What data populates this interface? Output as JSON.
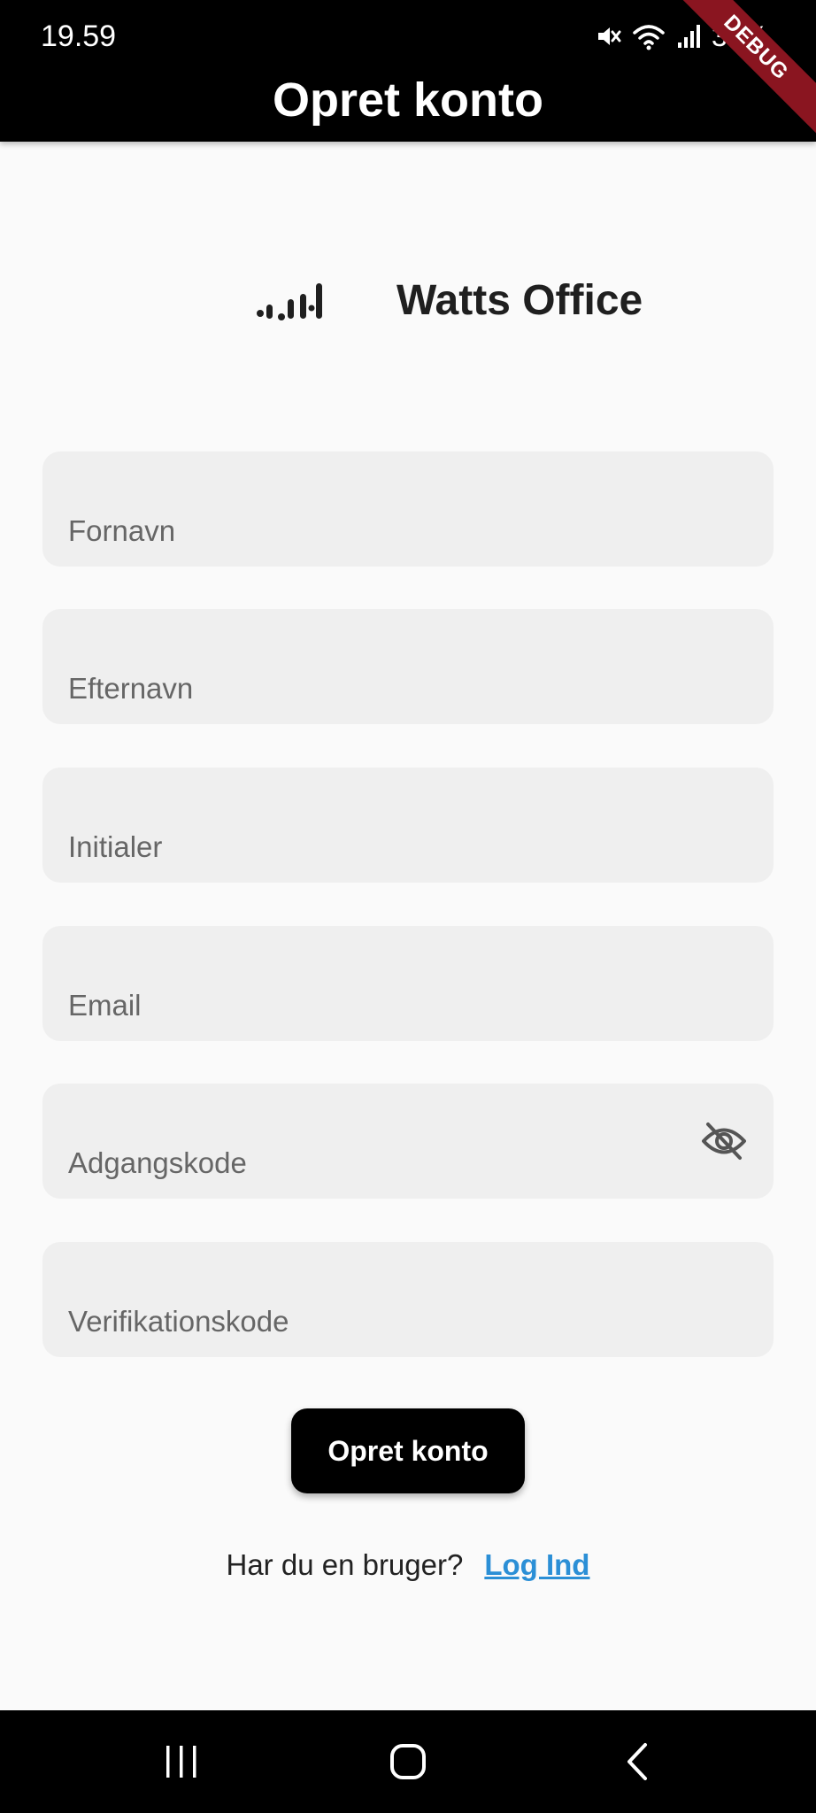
{
  "status_bar": {
    "time": "19.59",
    "battery": "38%",
    "icons": [
      "mute-icon",
      "wifi-icon",
      "signal-icon",
      "battery-icon"
    ]
  },
  "debug_banner": "DEBUG",
  "app_bar": {
    "title": "Opret konto"
  },
  "logo": {
    "icon": "waveform-logo-icon",
    "text": "Watts Office"
  },
  "form": {
    "fields": [
      {
        "placeholder": "Fornavn",
        "value": ""
      },
      {
        "placeholder": "Efternavn",
        "value": ""
      },
      {
        "placeholder": "Initialer",
        "value": ""
      },
      {
        "placeholder": "Email",
        "value": ""
      },
      {
        "placeholder": "Adgangskode",
        "value": "",
        "icon": "eye-off-icon"
      },
      {
        "placeholder": "Verifikationskode",
        "value": ""
      }
    ],
    "submit_label": "Opret konto"
  },
  "login_prompt": {
    "text": "Har du en bruger?",
    "link": "Log Ind"
  },
  "colors": {
    "app_bar": "#000000",
    "background": "#fafafa",
    "field_fill": "#efefef",
    "link": "#2b8fd6",
    "debug_banner": "#8a1520"
  },
  "nav_bar": {
    "icons": [
      "recent-apps-icon",
      "home-icon",
      "back-icon"
    ]
  }
}
